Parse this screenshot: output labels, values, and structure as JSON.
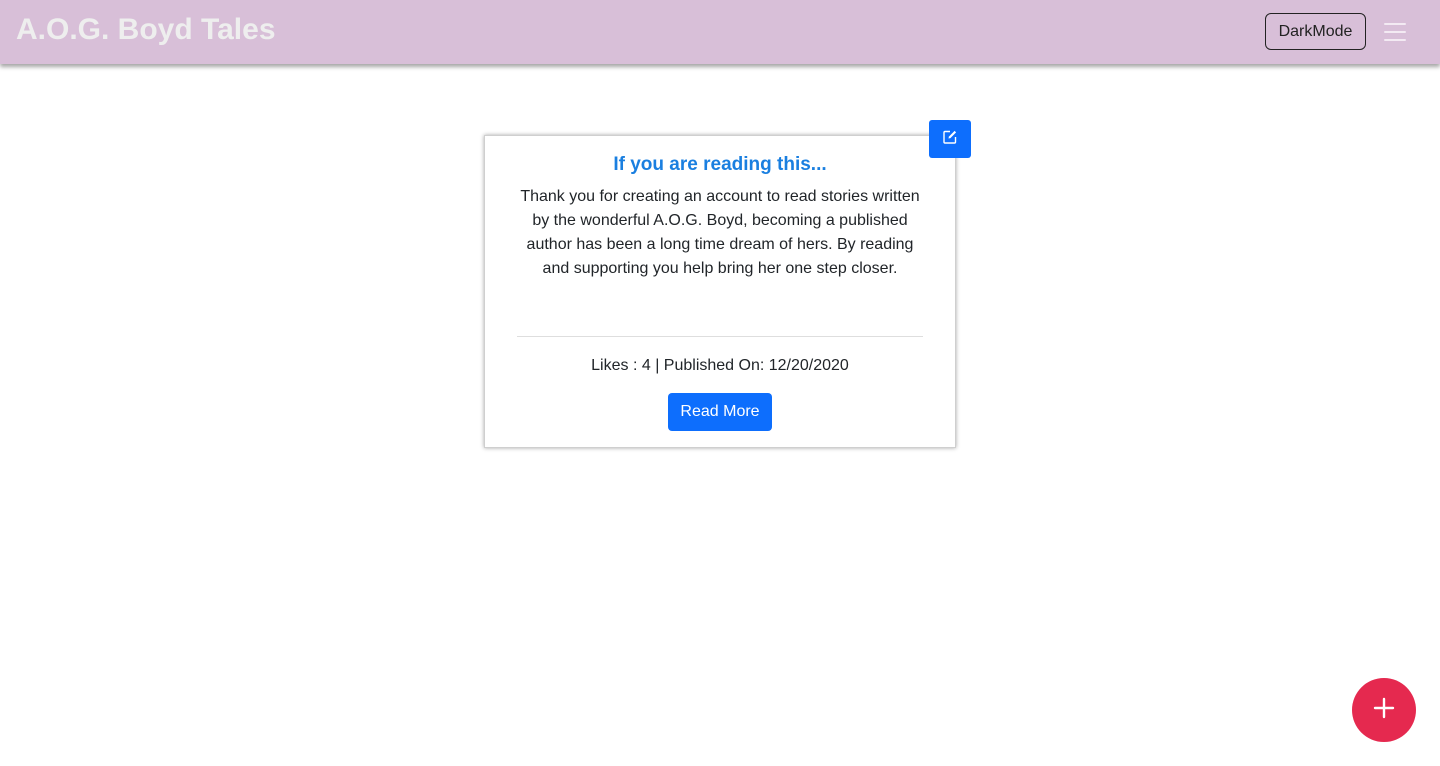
{
  "header": {
    "brand": "A.O.G. Boyd Tales",
    "darkmode_label": "DarkMode",
    "menu_icon": "hamburger-menu-icon",
    "background_color": "#d8bfd8"
  },
  "story_card": {
    "title": "If you are reading this...",
    "body": "Thank you for creating an account to read stories written by the wonderful A.O.G. Boyd, becoming a published author has been a long time dream of hers. By reading and supporting you help bring her one step closer.",
    "meta": "Likes : 4 | Published On: 12/20/2020",
    "read_more_label": "Read More",
    "edit_icon": "edit-icon",
    "title_color": "#1a7fe0",
    "accent_color": "#0d6efd"
  },
  "fab": {
    "icon": "plus-icon",
    "color": "#e5294f"
  }
}
